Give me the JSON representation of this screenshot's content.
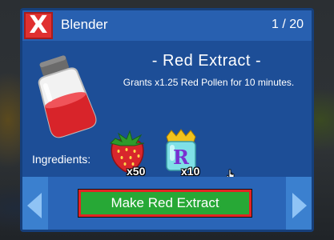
{
  "window": {
    "title": "Blender",
    "page_counter": "1 / 20",
    "close_label": "X"
  },
  "item": {
    "name": "- Red Extract -",
    "description": "Grants x1.25 Red Pollen for 10 minutes.",
    "icon": "red-extract-jar-icon"
  },
  "ingredients": {
    "label": "Ingredients:",
    "items": [
      {
        "icon": "strawberry-icon",
        "quantity": "x50"
      },
      {
        "icon": "royal-jelly-icon",
        "quantity": "x10"
      }
    ]
  },
  "footer": {
    "make_label": "Make Red Extract",
    "prev_icon": "arrow-left-icon",
    "next_icon": "arrow-right-icon"
  },
  "colors": {
    "panel": "#2a5fab",
    "close": "#e03030",
    "make_button": "#27a836",
    "make_button_border": "#e32424"
  }
}
